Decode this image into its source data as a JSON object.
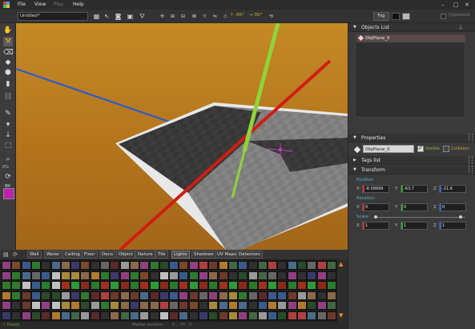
{
  "app": {
    "menu": [
      "File",
      "View",
      "Play",
      "Help"
    ],
    "menu_disabled": [
      false,
      false,
      true,
      false
    ],
    "window_controls": [
      "–",
      "□",
      "✕"
    ]
  },
  "toolbar": {
    "filename": "Untitled*",
    "angle_h": "↑ -65°",
    "angle_v": "→ 35°",
    "fog_label": "Fog",
    "clipboard_label": "Clipboard",
    "fog_colors": [
      "#111111",
      "#b8b8b8"
    ]
  },
  "left_tools": {
    "zoom_label": "0%",
    "brush_color": "#c020b0"
  },
  "palette": {
    "tabs": [
      "Wall",
      "Water",
      "Ceiling",
      "Floor",
      "Deco",
      "Object",
      "Nature",
      "Tile",
      "Lights",
      "Shadows",
      "UV Maps",
      "Detectors"
    ],
    "active_tab": "Lights"
  },
  "status": {
    "left": "↑ Heads",
    "mid": "Marker position",
    "coords": "0  ,  -74  ,  0"
  },
  "objects_list": {
    "title": "Objects List",
    "items": [
      "ObjPlane_0"
    ]
  },
  "properties": {
    "title": "Properties",
    "name": "ObjPlane_0",
    "visible_label": "Visible",
    "collision_label": "Collision",
    "tags_title": "Tags list",
    "transform_title": "Transform",
    "position_label": "Position",
    "rotation_label": "Rotation",
    "scale_label": "Scale",
    "position": {
      "x": "-8.09999",
      "y": "-63.7",
      "z": "-21.6"
    },
    "rotation": {
      "x": "0",
      "y": "0",
      "z": "0"
    },
    "scale": {
      "x": "1",
      "y": "1",
      "z": "1"
    }
  }
}
